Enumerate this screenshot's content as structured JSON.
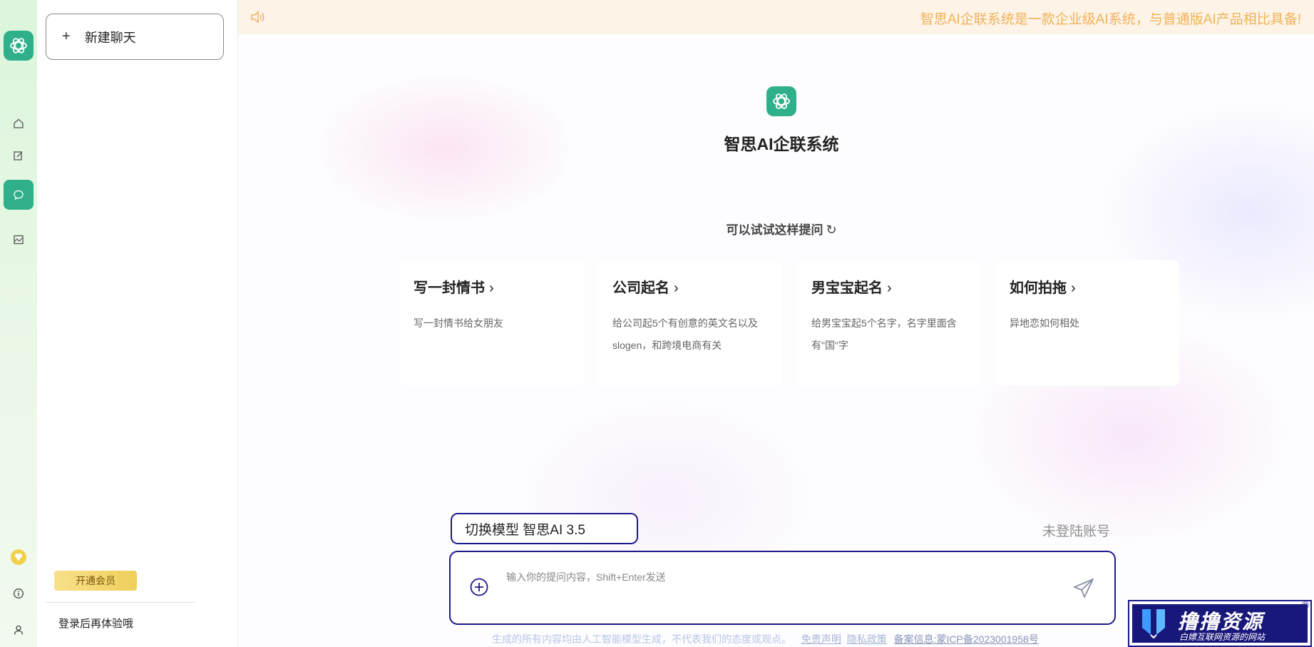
{
  "sidebar": {
    "new_chat_label": "新建聊天",
    "vip_label": "开通会员",
    "login_prompt": "登录后再体验哦"
  },
  "banner": {
    "text": "智思AI企联系统是一款企业级AI系统，与普通版AI产品相比具备!"
  },
  "main": {
    "app_title": "智思AI企联系统",
    "suggest_label": "可以试试这样提问",
    "cards": [
      {
        "title": "写一封情书",
        "desc": "写一封情书给女朋友"
      },
      {
        "title": "公司起名",
        "desc": "给公司起5个有创意的英文名以及slogen，和跨境电商有关"
      },
      {
        "title": "男宝宝起名",
        "desc": "给男宝宝起5个名字，名字里面含有\"国\"字"
      },
      {
        "title": "如何拍拖",
        "desc": "异地恋如何相处"
      }
    ],
    "model_switch_label": "切换模型 智思AI 3.5",
    "account_status": "未登陆账号",
    "input_placeholder": "输入你的提问内容，Shift+Enter发送"
  },
  "footer": {
    "disclaimer": "生成的所有内容均由人工智能模型生成，不代表我们的态度或观点。",
    "link_disclaimer": "免责声明",
    "link_privacy": "隐私政策",
    "icp": "备案信息:蒙ICP备2023001958号"
  },
  "watermark": {
    "title": "撸撸资源",
    "subtitle": "白嫖互联网资源的网站",
    "reg": "®"
  },
  "colors": {
    "brand_green": "#2fb08a",
    "accent_navy": "#1d1a8c",
    "banner_text": "#f0b25a",
    "banner_bg": "#fdf3e6"
  }
}
